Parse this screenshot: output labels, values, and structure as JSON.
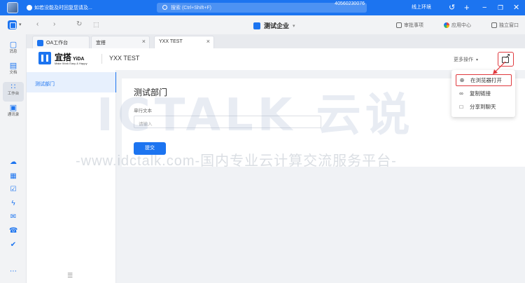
{
  "topbar": {
    "message": "如若没能及时回复您请及...",
    "search_placeholder": "搜索 (Ctrl+Shift+F)",
    "id_number": "40560230076",
    "env_label": "线上环境",
    "icons": [
      "history-icon",
      "plus-icon",
      "minimize-icon",
      "restore-icon",
      "close-icon"
    ]
  },
  "subbar": {
    "org_name": "测试企业",
    "approvals": "审批事项",
    "app_center": "应用中心",
    "standalone_window": "独立窗口"
  },
  "sidebar": {
    "items": [
      {
        "label": "消息",
        "icon": "message-icon"
      },
      {
        "label": "文档",
        "icon": "document-icon"
      },
      {
        "label": "工作台",
        "icon": "workbench-icon"
      },
      {
        "label": "通讯录",
        "icon": "contacts-icon"
      }
    ],
    "lower_icons": [
      "cloud-icon",
      "calendar-icon",
      "todo-icon",
      "lightning-icon",
      "mail-icon",
      "phone-icon",
      "check-icon",
      "more-icon"
    ]
  },
  "tabs": [
    {
      "label": "OA工作台",
      "has_icon": true
    },
    {
      "label": "宜搭",
      "has_icon": false
    },
    {
      "label": "YXX TEST",
      "has_icon": false
    }
  ],
  "header": {
    "brand": "宜搭",
    "brand_en": "YiDA",
    "slogan": "Make Work Easy & Happy",
    "app_name": "YXX TEST",
    "more_actions": "更多操作"
  },
  "left_nav": {
    "items": [
      {
        "label": "测试部门"
      }
    ]
  },
  "form": {
    "title": "测试部门",
    "field_label": "单行文本",
    "placeholder": "请输入",
    "submit": "提交"
  },
  "menu": {
    "items": [
      {
        "label": "在浏览器打开",
        "icon": "globe-icon"
      },
      {
        "label": "复制链接",
        "icon": "link-icon"
      },
      {
        "label": "分享到聊天",
        "icon": "chat-icon"
      }
    ]
  },
  "watermark": {
    "big": "ICTALK 云说",
    "line": "-www.idctalk.com-国内专业云计算交流服务平台-"
  },
  "colors": {
    "primary": "#1c74f0",
    "highlight_red": "#e0393e"
  }
}
